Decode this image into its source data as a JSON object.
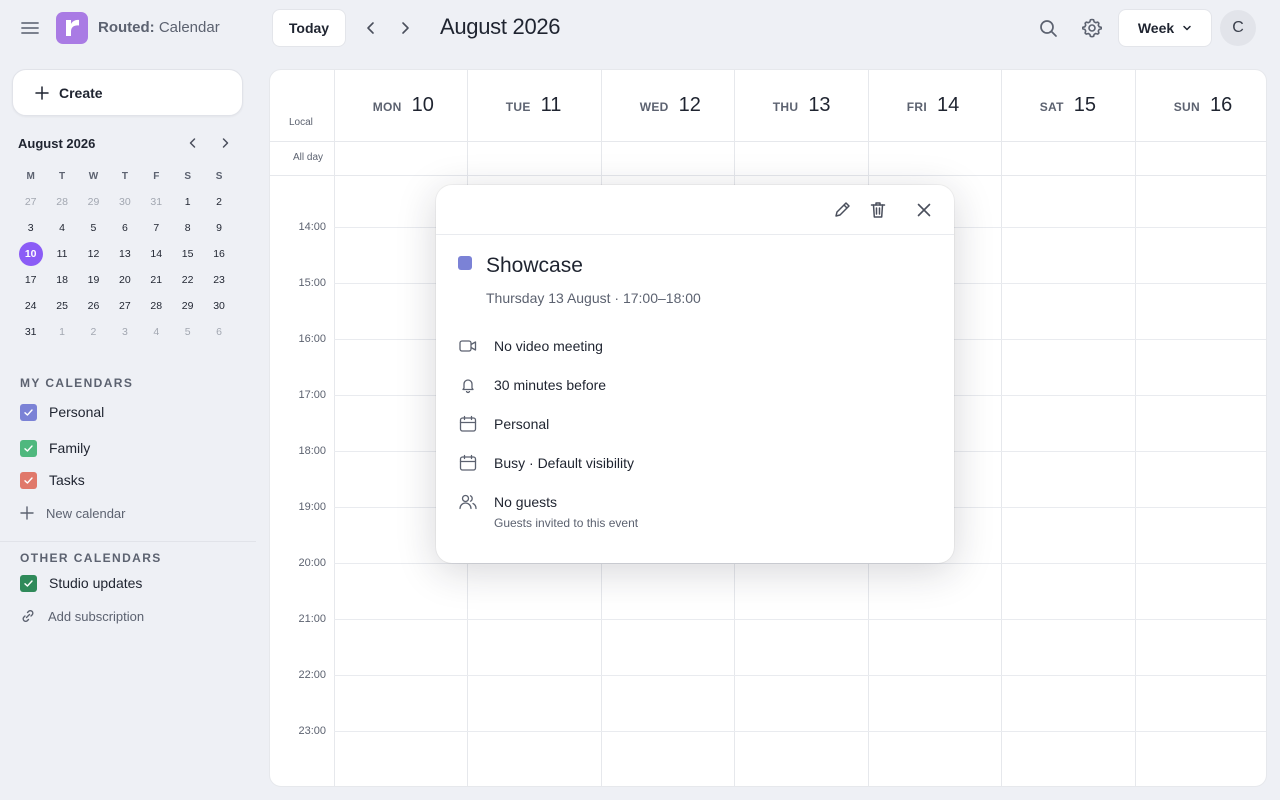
{
  "header": {
    "brand_strong": "Routed:",
    "brand_rest": " Calendar",
    "today_label": "Today",
    "month_title": "August 2026",
    "view_label": "Week",
    "avatar_initial": "C"
  },
  "sidebar": {
    "create_label": "Create",
    "mini_calendar": {
      "title": "August 2026",
      "weekdays": [
        "M",
        "T",
        "W",
        "T",
        "F",
        "S",
        "S"
      ],
      "weeks": [
        [
          "27",
          "28",
          "29",
          "30",
          "31",
          "1",
          "2"
        ],
        [
          "3",
          "4",
          "5",
          "6",
          "7",
          "8",
          "9"
        ],
        [
          "10",
          "11",
          "12",
          "13",
          "14",
          "15",
          "16"
        ],
        [
          "17",
          "18",
          "19",
          "20",
          "21",
          "22",
          "23"
        ],
        [
          "24",
          "25",
          "26",
          "27",
          "28",
          "29",
          "30"
        ],
        [
          "31",
          "1",
          "2",
          "3",
          "4",
          "5",
          "6"
        ]
      ],
      "selected": "10"
    },
    "my_calendars_title": "MY CALENDARS",
    "my_calendars": [
      {
        "name": "Personal",
        "color": "#7b82d6"
      },
      {
        "name": "Family",
        "color": "#4fb87e"
      },
      {
        "name": "Tasks",
        "color": "#e0786a"
      }
    ],
    "new_calendar_label": "New calendar",
    "other_calendars_title": "OTHER CALENDARS",
    "other_calendars": [
      {
        "name": "Studio updates",
        "color": "#2f8a5a"
      }
    ],
    "add_subscription_label": "Add subscription"
  },
  "week": {
    "local_label": "Local",
    "all_day_label": "All day",
    "days": [
      {
        "dow": "MON",
        "num": "10"
      },
      {
        "dow": "TUE",
        "num": "11"
      },
      {
        "dow": "WED",
        "num": "12"
      },
      {
        "dow": "THU",
        "num": "13"
      },
      {
        "dow": "FRI",
        "num": "14"
      },
      {
        "dow": "SAT",
        "num": "15"
      },
      {
        "dow": "SUN",
        "num": "16"
      }
    ],
    "hours": [
      "14:00",
      "15:00",
      "16:00",
      "17:00",
      "18:00",
      "19:00",
      "20:00",
      "21:00",
      "22:00",
      "23:00"
    ]
  },
  "event_popup": {
    "title": "Showcase",
    "time": "Thursday 13 August · 17:00–18:00",
    "color": "#7b82d6",
    "video": "No video meeting",
    "reminder": "30 minutes before",
    "calendar": "Personal",
    "availability": "Busy · Default visibility",
    "guests": "No guests",
    "guests_sub": "Guests invited to this event"
  }
}
